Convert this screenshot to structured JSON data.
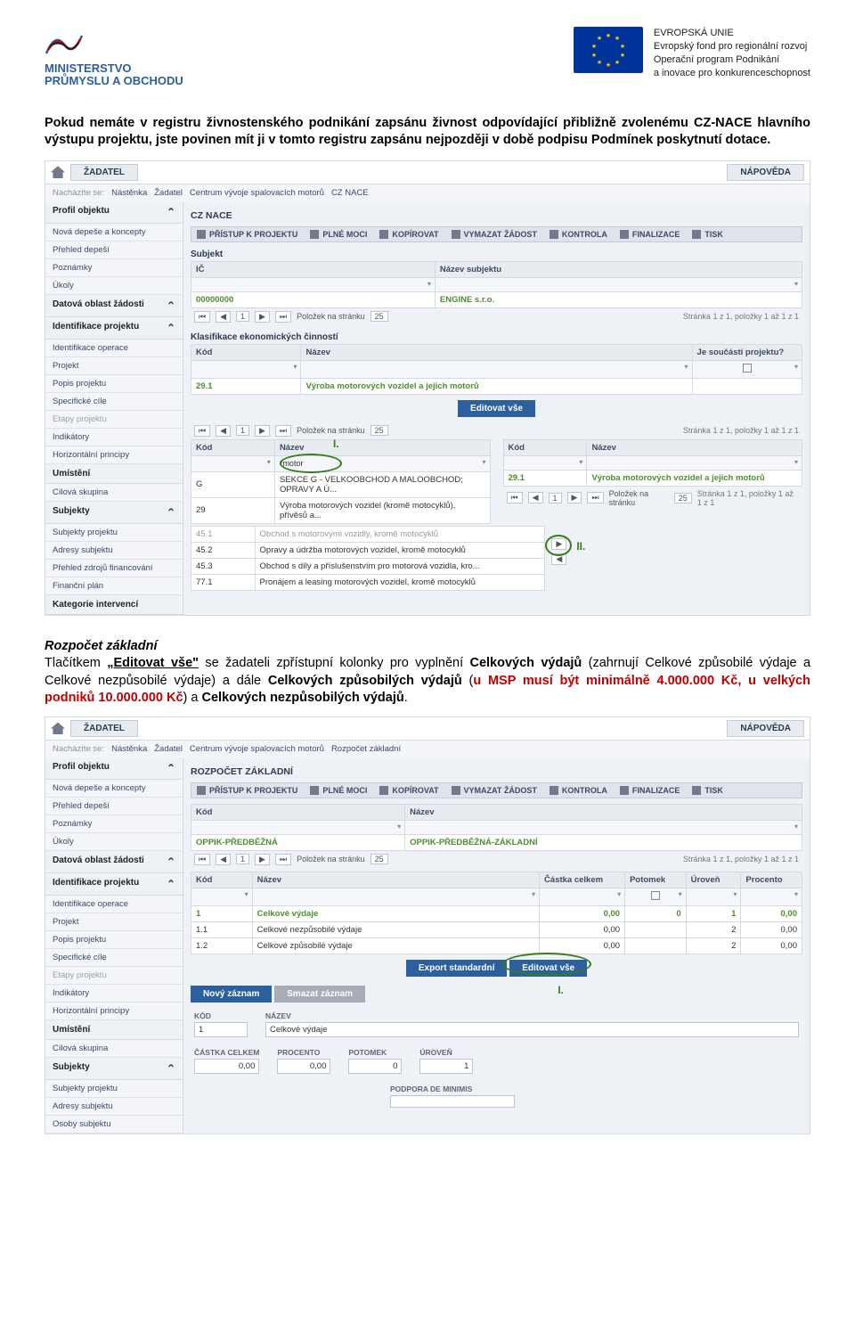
{
  "logo_left": {
    "line1": "MINISTERSTVO",
    "line2": "PRŮMYSLU A OBCHODU"
  },
  "eu": {
    "l1": "EVROPSKÁ UNIE",
    "l2": "Evropský fond pro regionální rozvoj",
    "l3": "Operační program Podnikání",
    "l4": "a inovace pro konkurenceschopnost"
  },
  "para1": "Pokud nemáte v registru živnostenského podnikání zapsánu živnost odpovídající přibližně zvolenému CZ-NACE hlavního výstupu projektu, jste povinen mít ji v tomto registru zapsánu nejpozději v době podpisu Podmínek poskytnutí dotace.",
  "para2": {
    "h": "Rozpočet základní",
    "t1": "Tlačítkem ",
    "btn": "„Editovat vše\"",
    "t2": " se žadateli zpřístupní kolonky pro vyplnění ",
    "b1": "Celkových výdajů",
    "t3": " (zahrnují Celkové způsobilé výdaje a Celkové nezpůsobilé výdaje) a dále ",
    "b2": "Celkových způsobilých výdajů",
    "t4": " (",
    "r": "u MSP musí být minimálně 4.000.000 Kč, u velkých podniků 10.000.000 Kč",
    "t5": ") a ",
    "b3": "Celkových nezpůsobilých výdajů",
    "t6": "."
  },
  "app": {
    "tab_zadatel": "ŽADATEL",
    "tab_napoveda": "NÁPOVĚDA",
    "crumb_lbl": "Nacházíte se:",
    "crumb1": "Nástěnka",
    "crumb2": "Žadatel",
    "crumb3": "Centrum vývoje spalovacích motorů",
    "crumb_cz": "CZ NACE",
    "crumb_rz": "Rozpočet základní"
  },
  "sidebar": {
    "profil": "Profil objektu",
    "items1": [
      "Nová depeše a koncepty",
      "Přehled depeší",
      "Poznámky",
      "Úkoly"
    ],
    "datova": "Datová oblast žádosti",
    "ident": "Identifikace projektu",
    "items2": [
      "Identifikace operace",
      "Projekt",
      "Popis projektu",
      "Specifické cíle"
    ],
    "etapy": "Etapy projektu",
    "items3": [
      "Indikátory",
      "Horizontální principy"
    ],
    "um": "Umístění",
    "cil": "Cílová skupina",
    "subj": "Subjekty",
    "items4": [
      "Subjekty projektu",
      "Adresy subjektu"
    ],
    "items4b": [
      "Subjekty projektu",
      "Adresy subjektu",
      "Osoby subjektu"
    ],
    "extra1": [
      "Přehled zdrojů financování",
      "Finanční plán"
    ],
    "kat": "Kategorie intervencí"
  },
  "toolbar": {
    "pristup": "PŘÍSTUP K PROJEKTU",
    "plne": "PLNÉ MOCI",
    "kop": "KOPÍROVAT",
    "vym": "VYMAZAT ŽÁDOST",
    "kont": "KONTROLA",
    "fin": "FINALIZACE",
    "tisk": "TISK"
  },
  "s1": {
    "title": "CZ NACE",
    "subjekt": "Subjekt",
    "ic": "IČ",
    "nazev_sub": "Název subjektu",
    "ic_val": "00000000",
    "nazev_val": "ENGINE s.r.o.",
    "pol": "Položek na stránku",
    "pol25": "25",
    "pgtxt": "Stránka 1 z 1, položky 1 až 1 z 1",
    "klas": "Klasifikace ekonomických činností",
    "kod": "Kód",
    "nazev": "Název",
    "jesouc": "Je součástí projektu?",
    "r1_kod": "29.1",
    "r1_naz": "Výroba motorových vozidel a jejich motorů",
    "edit": "Editovat vše",
    "star_motor": "*motor",
    "left_rows": [
      {
        "k": "G",
        "n": "SEKCE G - VELKOOBCHOD A MALOOBCHOD; OPRAVY A Ú..."
      },
      {
        "k": "29",
        "n": "Výroba motorových vozidel (kromě motocyklů), přívěsů a..."
      }
    ],
    "right_rows": [
      {
        "k": "29.1",
        "n": "Výroba motorových vozidel a jejich motorů"
      }
    ],
    "bottom_rows": [
      {
        "k": "45.1",
        "n": "Obchod s motorovými vozidly, kromě motocyklů"
      },
      {
        "k": "45.2",
        "n": "Opravy a údržba motorových vozidel, kromě motocyklů"
      },
      {
        "k": "45.3",
        "n": "Obchod s díly a příslušenstvím pro motorová vozidla, kro..."
      },
      {
        "k": "77.1",
        "n": "Pronájem a leasing motorových vozidel, kromě motocyklů"
      }
    ],
    "anno1": "I.",
    "anno2": "II."
  },
  "s2": {
    "title": "ROZPOČET ZÁKLADNÍ",
    "kod": "Kód",
    "nazev": "Název",
    "r_kod": "OPPIK-PŘEDBĚŽNÁ",
    "r_naz": "OPPIK-PŘEDBĚŽNÁ-ZÁKLADNÍ",
    "pgtxt": "Stránka 1 z 1, položky 1 až 1 z 1",
    "h_kod": "Kód",
    "h_naz": "Název",
    "h_cast": "Částka celkem",
    "h_pot": "Potomek",
    "h_ur": "Úroveň",
    "h_proc": "Procento",
    "rows": [
      {
        "k": "1",
        "n": "Celkové výdaje",
        "c": "0,00",
        "p": "0",
        "u": "1",
        "pr": "0,00"
      },
      {
        "k": "1.1",
        "n": "Celkové nezpůsobilé výdaje",
        "c": "0,00",
        "p": "",
        "u": "2",
        "pr": "0,00"
      },
      {
        "k": "1.2",
        "n": "Celkové způsobilé výdaje",
        "c": "0,00",
        "p": "",
        "u": "2",
        "pr": "0,00"
      }
    ],
    "export": "Export standardní",
    "edit": "Editovat vše",
    "novy": "Nový záznam",
    "smaz": "Smazat záznam",
    "f_kod": "KÓD",
    "f_kod_v": "1",
    "f_naz": "NÁZEV",
    "f_naz_v": "Celkové výdaje",
    "f_cast": "ČÁSTKA CELKEM",
    "f_cast_v": "0,00",
    "f_proc": "PROCENTO",
    "f_proc_v": "0,00",
    "f_pot": "POTOMEK",
    "f_pot_v": "0",
    "f_ur": "ÚROVEŇ",
    "f_ur_v": "1",
    "f_pod": "PODPORA DE MINIMIS",
    "anno1": "I.",
    "pol": "Položek na stránku",
    "pol25": "25"
  }
}
